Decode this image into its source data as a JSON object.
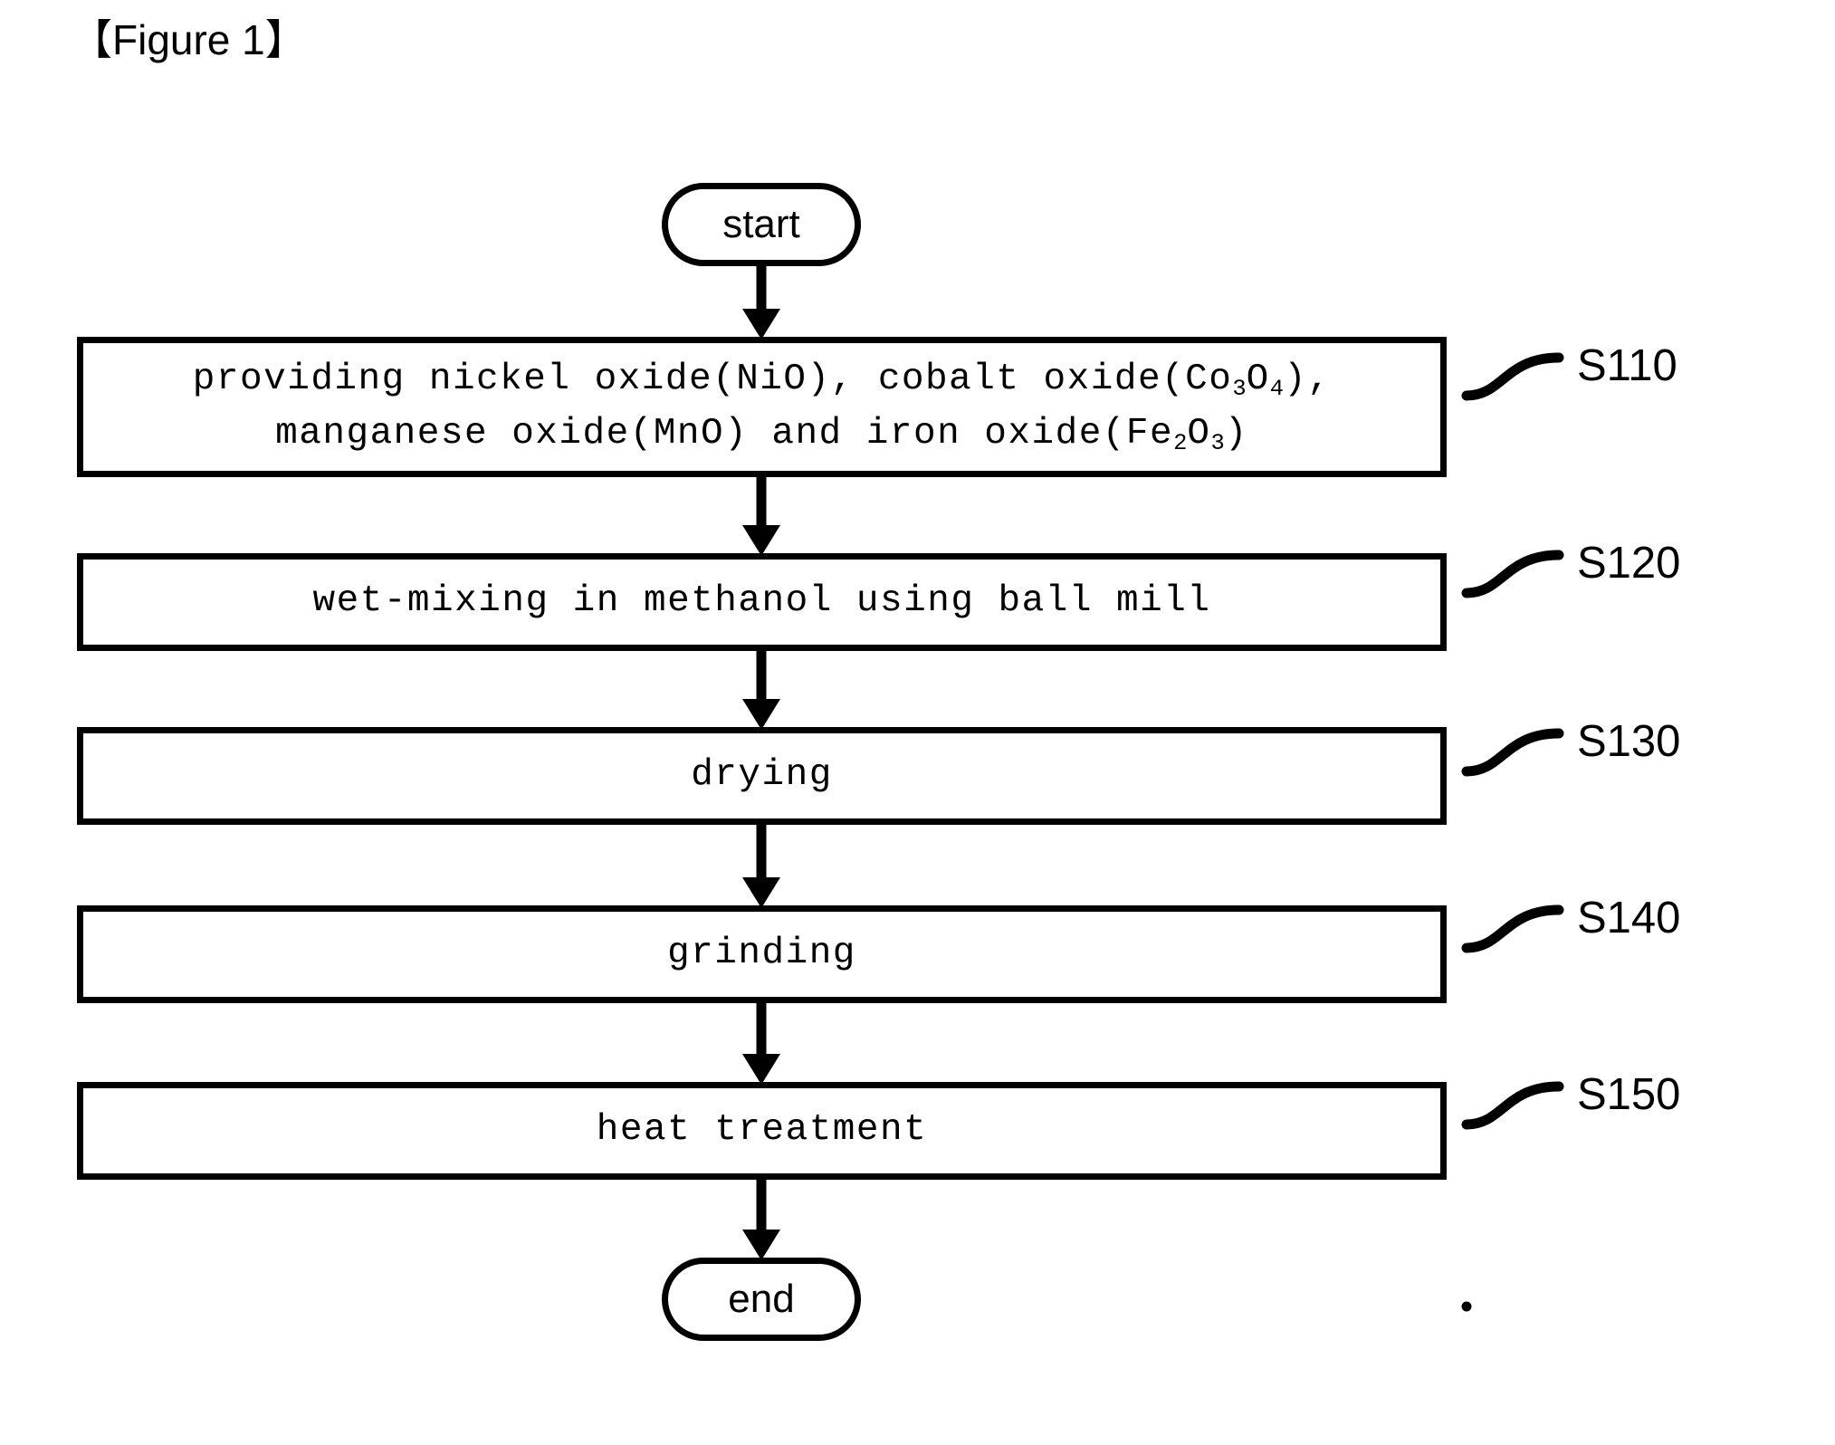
{
  "figure": {
    "title": "【Figure 1】"
  },
  "theme": {
    "stroke": "#000000",
    "background": "#ffffff",
    "fill": "#ffffff"
  },
  "flowchart": {
    "type": "flowchart",
    "orientation": "top-to-bottom",
    "nodes": [
      {
        "id": "start",
        "shape": "terminator",
        "label": "start"
      },
      {
        "id": "s110",
        "shape": "process",
        "step": "S110",
        "line1_a": "providing nickel oxide(NiO), cobalt oxide(Co",
        "line1_sub1": "3",
        "line1_b": "O",
        "line1_sub2": "4",
        "line1_c": "),",
        "line2_a": "manganese oxide(MnO) and iron oxide(Fe",
        "line2_sub1": "2",
        "line2_b": "O",
        "line2_sub2": "3",
        "line2_c": ")",
        "plain_text": "providing nickel oxide(NiO), cobalt oxide(Co3O4), manganese oxide(MnO) and iron oxide(Fe2O3)"
      },
      {
        "id": "s120",
        "shape": "process",
        "step": "S120",
        "label": "wet-mixing in methanol using ball mill"
      },
      {
        "id": "s130",
        "shape": "process",
        "step": "S130",
        "label": "drying"
      },
      {
        "id": "s140",
        "shape": "process",
        "step": "S140",
        "label": "grinding"
      },
      {
        "id": "s150",
        "shape": "process",
        "step": "S150",
        "label": "heat treatment"
      },
      {
        "id": "end",
        "shape": "terminator",
        "label": "end"
      }
    ],
    "edges": [
      {
        "from": "start",
        "to": "s110",
        "arrow": "down"
      },
      {
        "from": "s110",
        "to": "s120",
        "arrow": "down"
      },
      {
        "from": "s120",
        "to": "s130",
        "arrow": "down"
      },
      {
        "from": "s130",
        "to": "s140",
        "arrow": "down"
      },
      {
        "from": "s140",
        "to": "s150",
        "arrow": "down"
      },
      {
        "from": "s150",
        "to": "end",
        "arrow": "down"
      }
    ],
    "step_labels": [
      "S110",
      "S120",
      "S130",
      "S140",
      "S150"
    ]
  }
}
